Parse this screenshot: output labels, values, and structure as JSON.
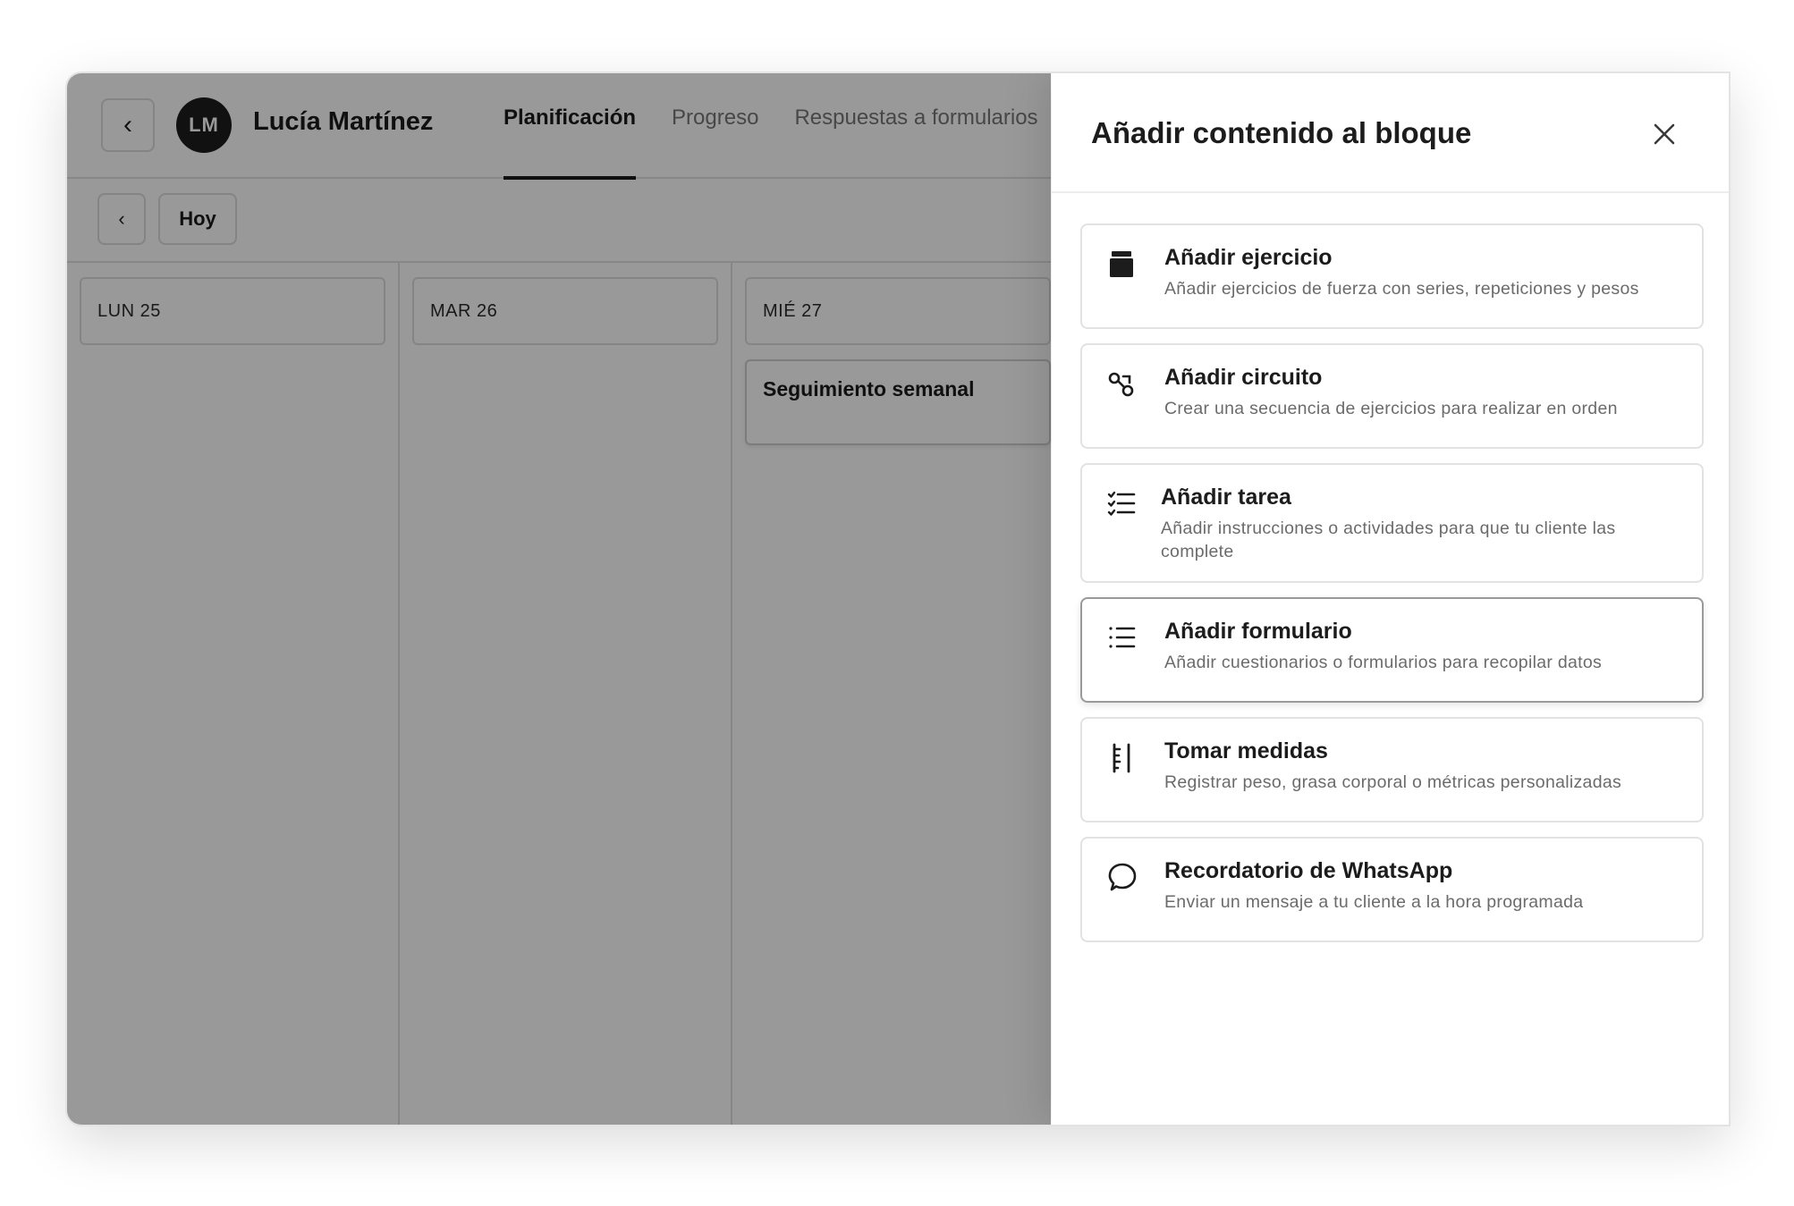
{
  "client": {
    "initials": "LM",
    "name": "Lucía Martínez"
  },
  "nav": {
    "back_label": "‹",
    "tabs": [
      {
        "label": "Planificación",
        "active": true
      },
      {
        "label": "Progreso",
        "active": false
      },
      {
        "label": "Respuestas a formularios",
        "active": false
      }
    ]
  },
  "toolbar": {
    "prev_label": "‹",
    "today_label": "Hoy"
  },
  "calendar": {
    "days": [
      {
        "label": "LUN 25"
      },
      {
        "label": "MAR 26"
      },
      {
        "label": "MIÉ 27"
      }
    ],
    "events": [
      {
        "day": "MIÉ 27",
        "title": "Seguimiento semanal"
      }
    ]
  },
  "drawer": {
    "title": "Añadir contenido al bloque",
    "close_icon": "close-icon",
    "options": [
      {
        "icon": "exercise-icon",
        "title": "Añadir ejercicio",
        "description": "Añadir ejercicios de fuerza con series, repeticiones y pesos",
        "selected": false
      },
      {
        "icon": "circuit-icon",
        "title": "Añadir circuito",
        "description": "Crear una secuencia de ejercicios para realizar en orden",
        "selected": false
      },
      {
        "icon": "task-list-icon",
        "title": "Añadir tarea",
        "description": "Añadir instrucciones o actividades para que tu cliente las complete",
        "selected": false
      },
      {
        "icon": "form-list-icon",
        "title": "Añadir formulario",
        "description": "Añadir cuestionarios o formularios para recopilar datos",
        "selected": true
      },
      {
        "icon": "ruler-icon",
        "title": "Tomar medidas",
        "description": "Registrar peso, grasa corporal o métricas personalizadas",
        "selected": false
      },
      {
        "icon": "chat-bubble-icon",
        "title": "Recordatorio de WhatsApp",
        "description": "Enviar un mensaje a tu cliente a la hora programada",
        "selected": false
      }
    ]
  },
  "colors": {
    "overlay": "#000000",
    "text_primary": "#1c1c1c",
    "text_secondary": "#6b6b6b",
    "border": "#e2e2e2",
    "avatar_bg": "#1d1d1d"
  }
}
